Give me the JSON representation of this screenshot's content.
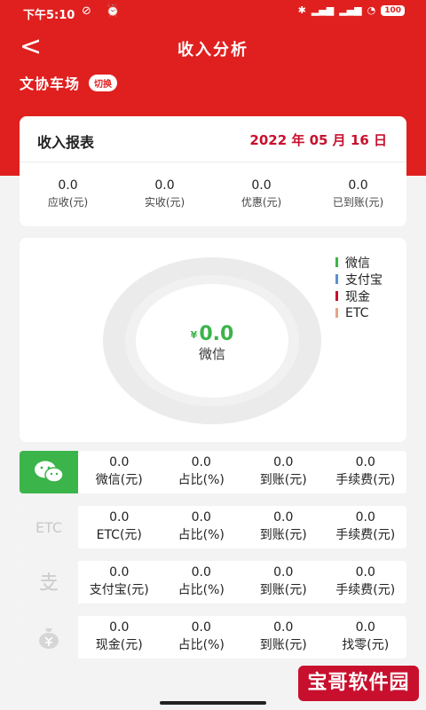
{
  "status": {
    "time": "下午5:10",
    "battery": "100"
  },
  "header": {
    "title": "收入分析",
    "back_glyph": "<"
  },
  "store": {
    "name": "文协车场",
    "switch_label": "切换"
  },
  "report": {
    "title": "收入报表",
    "date": "2022 年 05 月 16 日",
    "stats": [
      {
        "value": "0.0",
        "label": "应收(元)"
      },
      {
        "value": "0.0",
        "label": "实收(元)"
      },
      {
        "value": "0.0",
        "label": "优惠(元)"
      },
      {
        "value": "0.0",
        "label": "已到账(元)"
      }
    ]
  },
  "chart": {
    "center_currency": "¥",
    "center_value": "0.0",
    "center_label": "微信",
    "legend": [
      {
        "label": "微信",
        "color": "#3bb44a"
      },
      {
        "label": "支付宝",
        "color": "#5b8fd0"
      },
      {
        "label": "现金",
        "color": "#c8102e"
      },
      {
        "label": "ETC",
        "color": "#e7a48a"
      }
    ]
  },
  "rows": [
    {
      "icon": "wechat-icon",
      "cols": [
        {
          "value": "0.0",
          "label": "微信(元)"
        },
        {
          "value": "0.0",
          "label": "占比(%)"
        },
        {
          "value": "0.0",
          "label": "到账(元)"
        },
        {
          "value": "0.0",
          "label": "手续费(元)"
        }
      ]
    },
    {
      "icon": "etc-icon",
      "icon_text": "ETC",
      "cols": [
        {
          "value": "0.0",
          "label": "ETC(元)"
        },
        {
          "value": "0.0",
          "label": "占比(%)"
        },
        {
          "value": "0.0",
          "label": "到账(元)"
        },
        {
          "value": "0.0",
          "label": "手续费(元)"
        }
      ]
    },
    {
      "icon": "alipay-icon",
      "cols": [
        {
          "value": "0.0",
          "label": "支付宝(元)"
        },
        {
          "value": "0.0",
          "label": "占比(%)"
        },
        {
          "value": "0.0",
          "label": "到账(元)"
        },
        {
          "value": "0.0",
          "label": "手续费(元)"
        }
      ]
    },
    {
      "icon": "cash-icon",
      "cols": [
        {
          "value": "0.0",
          "label": "现金(元)"
        },
        {
          "value": "0.0",
          "label": "占比(%)"
        },
        {
          "value": "0.0",
          "label": "到账(元)"
        },
        {
          "value": "0.0",
          "label": "找零(元)"
        }
      ]
    }
  ],
  "watermark": "宝哥软件园",
  "colors": {
    "brand": "#e0201f",
    "accent_date": "#c8102e",
    "wechat": "#3bb44a"
  }
}
